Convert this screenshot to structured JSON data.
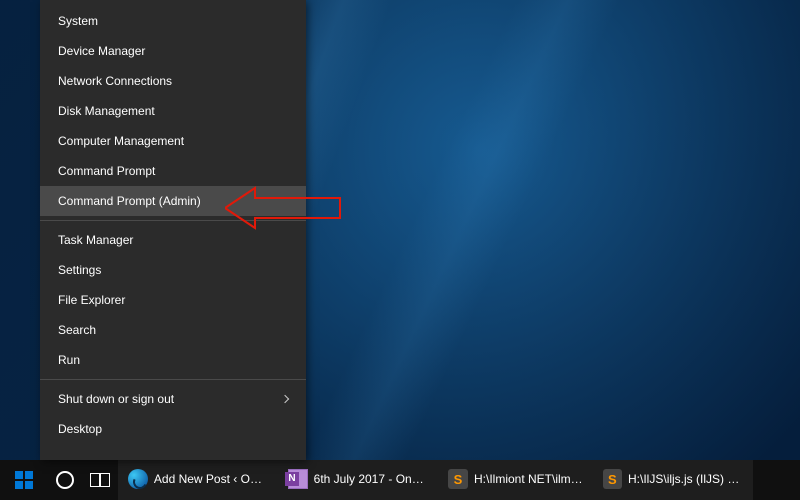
{
  "menu": {
    "group1": [
      "System",
      "Device Manager",
      "Network Connections",
      "Disk Management",
      "Computer Management",
      "Command Prompt",
      "Command Prompt (Admin)"
    ],
    "group2": [
      "Task Manager",
      "Settings",
      "File Explorer",
      "Search",
      "Run"
    ],
    "group3_submenu": "Shut down or sign out",
    "group3_last": "Desktop",
    "highlighted_index": 6
  },
  "taskbar": {
    "tasks": [
      {
        "icon": "edge",
        "label": "Add New Post ‹ On…"
      },
      {
        "icon": "onenote",
        "label": "6th July 2017 - One…"
      },
      {
        "icon": "sublime",
        "label": "H:\\Ilmiont NET\\ilm…"
      },
      {
        "icon": "sublime",
        "label": "H:\\IlJS\\iljs.js (IlJS) - …"
      }
    ]
  }
}
